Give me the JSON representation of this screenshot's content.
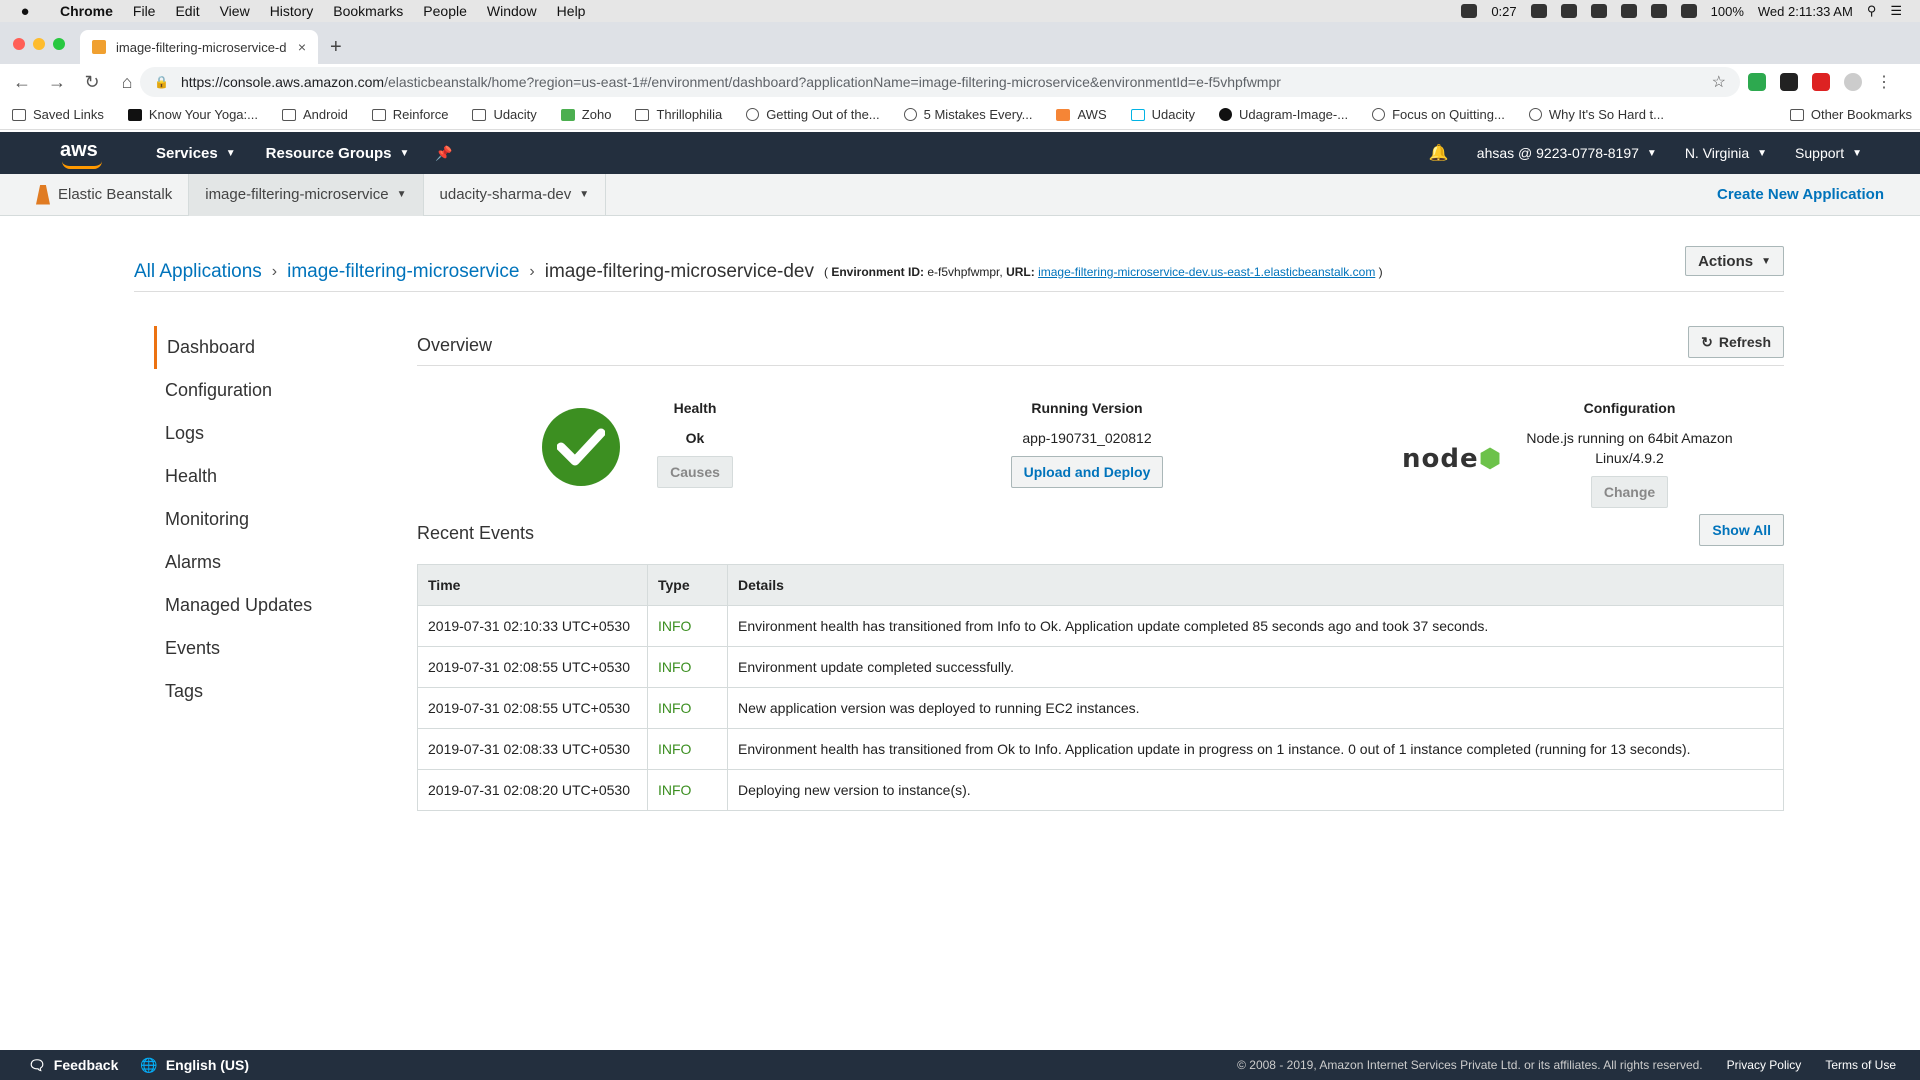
{
  "mac_menu": {
    "apple": "",
    "app": "Chrome",
    "items": [
      "File",
      "Edit",
      "View",
      "History",
      "Bookmarks",
      "People",
      "Window",
      "Help"
    ],
    "timer": "0:27",
    "battery": "100%",
    "clock": "Wed 2:11:33 AM"
  },
  "browser": {
    "tab_title": "image-filtering-microservice-d",
    "tab_close": "×",
    "new_tab": "+",
    "url_host": "https://console.aws.amazon.com",
    "url_path": "/elasticbeanstalk/home?region=us-east-1#/environment/dashboard?applicationName=image-filtering-microservice&environmentId=e-f5vhpfwmpr",
    "bookmarks": [
      "Saved Links",
      "Know Your Yoga:...",
      "Android",
      "Reinforce",
      "Udacity",
      "Zoho",
      "Thrillophilia",
      "Getting Out of the...",
      "5 Mistakes Every...",
      "AWS",
      "Udacity",
      "Udagram-Image-...",
      "Focus on Quitting...",
      "Why It's So Hard t..."
    ],
    "other_bookmarks": "Other Bookmarks"
  },
  "aws_nav": {
    "logo": "aws",
    "services": "Services",
    "resource_groups": "Resource Groups",
    "account": "ahsas @ 9223-0778-8197",
    "region": "N. Virginia",
    "support": "Support"
  },
  "service_bar": {
    "service": "Elastic Beanstalk",
    "app": "image-filtering-microservice",
    "env": "udacity-sharma-dev",
    "create": "Create New Application"
  },
  "breadcrumb": {
    "all": "All Applications",
    "app": "image-filtering-microservice",
    "env": "image-filtering-microservice-dev",
    "env_id_label": "Environment ID:",
    "env_id": "e-f5vhpfwmpr,",
    "url_label": "URL:",
    "url": "image-filtering-microservice-dev.us-east-1.elasticbeanstalk.com",
    "open_paren": "(",
    "close_paren": ")",
    "actions": "Actions"
  },
  "side_nav": [
    "Dashboard",
    "Configuration",
    "Logs",
    "Health",
    "Monitoring",
    "Alarms",
    "Managed Updates",
    "Events",
    "Tags"
  ],
  "overview": {
    "title": "Overview",
    "refresh": "Refresh",
    "health_label": "Health",
    "health_value": "Ok",
    "causes": "Causes",
    "version_label": "Running Version",
    "version_value": "app-190731_020812",
    "upload": "Upload and Deploy",
    "config_label": "Configuration",
    "config_value": "Node.js running on 64bit Amazon Linux/4.9.2",
    "change": "Change",
    "node_logo": "node"
  },
  "events": {
    "title": "Recent Events",
    "show_all": "Show All",
    "headers": [
      "Time",
      "Type",
      "Details"
    ],
    "rows": [
      [
        "2019-07-31 02:10:33 UTC+0530",
        "INFO",
        "Environment health has transitioned from Info to Ok. Application update completed 85 seconds ago and took 37 seconds."
      ],
      [
        "2019-07-31 02:08:55 UTC+0530",
        "INFO",
        "Environment update completed successfully."
      ],
      [
        "2019-07-31 02:08:55 UTC+0530",
        "INFO",
        "New application version was deployed to running EC2 instances."
      ],
      [
        "2019-07-31 02:08:33 UTC+0530",
        "INFO",
        "Environment health has transitioned from Ok to Info. Application update in progress on 1 instance. 0 out of 1 instance completed (running for 13 seconds)."
      ],
      [
        "2019-07-31 02:08:20 UTC+0530",
        "INFO",
        "Deploying new version to instance(s)."
      ]
    ]
  },
  "footer": {
    "feedback": "Feedback",
    "language": "English (US)",
    "copyright": "© 2008 - 2019, Amazon Internet Services Private Ltd. or its affiliates. All rights reserved.",
    "privacy": "Privacy Policy",
    "terms": "Terms of Use"
  },
  "colors": {
    "aws_nav": "#232f3e",
    "link": "#0073bb",
    "health_ok": "#3c8f21",
    "accent": "#ec7211"
  }
}
